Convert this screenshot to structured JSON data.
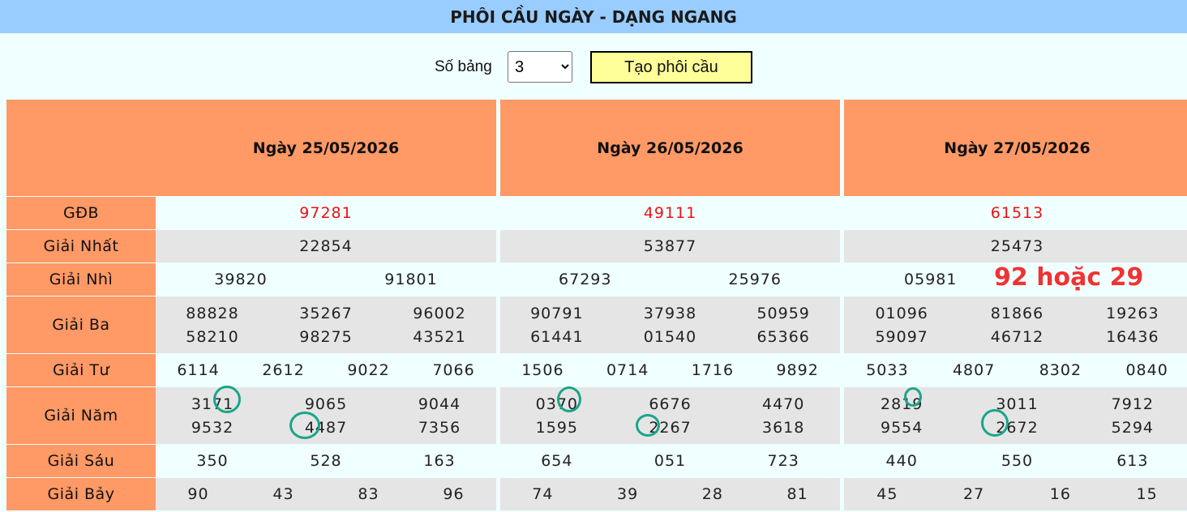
{
  "title": "PHÔI CẦU NGÀY - DẠNG NGANG",
  "controls": {
    "so_bang_label": "Số bảng",
    "so_bang_value": "3",
    "button_label": "Tạo phôi cầu"
  },
  "row_labels": [
    "GĐB",
    "Giải Nhất",
    "Giải Nhì",
    "Giải Ba",
    "Giải Tư",
    "Giải Năm",
    "Giải Sáu",
    "Giải Bảy"
  ],
  "tables": [
    {
      "date": "Ngày 25/05/2026",
      "gdb": [
        "97281"
      ],
      "nhat": [
        "22854"
      ],
      "nhi": [
        "39820",
        "91801"
      ],
      "ba": [
        "88828",
        "35267",
        "96002",
        "58210",
        "98275",
        "43521"
      ],
      "tu": [
        "6114",
        "2612",
        "9022",
        "7066"
      ],
      "nam": [
        "3171",
        "9065",
        "9044",
        "9532",
        "4487",
        "7356"
      ],
      "sau": [
        "350",
        "528",
        "163"
      ],
      "bay": [
        "90",
        "43",
        "83",
        "96"
      ]
    },
    {
      "date": "Ngày 26/05/2026",
      "gdb": [
        "49111"
      ],
      "nhat": [
        "53877"
      ],
      "nhi": [
        "67293",
        "25976"
      ],
      "ba": [
        "90791",
        "37938",
        "50959",
        "61441",
        "01540",
        "65366"
      ],
      "tu": [
        "1506",
        "0714",
        "1716",
        "9892"
      ],
      "nam": [
        "0370",
        "6676",
        "4470",
        "1595",
        "2267",
        "3618"
      ],
      "sau": [
        "654",
        "051",
        "723"
      ],
      "bay": [
        "74",
        "39",
        "28",
        "81"
      ]
    },
    {
      "date": "Ngày 27/05/2026",
      "gdb": [
        "61513"
      ],
      "nhat": [
        "25473"
      ],
      "nhi": [
        "05981",
        ""
      ],
      "ba": [
        "01096",
        "81866",
        "19263",
        "59097",
        "46712",
        "16436"
      ],
      "tu": [
        "5033",
        "4807",
        "8302",
        "0840"
      ],
      "nam": [
        "2819",
        "3011",
        "7912",
        "9554",
        "2672",
        "5294"
      ],
      "sau": [
        "440",
        "550",
        "613"
      ],
      "bay": [
        "45",
        "27",
        "16",
        "15"
      ]
    }
  ],
  "annotation": "92 hoặc 29",
  "colors": {
    "title_bar": "#99ccff",
    "header": "#ff9966",
    "light_row": "#f0ffff",
    "gray_row": "#e5e5e5",
    "special_prize": "#ee1111",
    "button": "#ffff99",
    "circle": "#1aa58a",
    "annotation": "#ee3333"
  }
}
